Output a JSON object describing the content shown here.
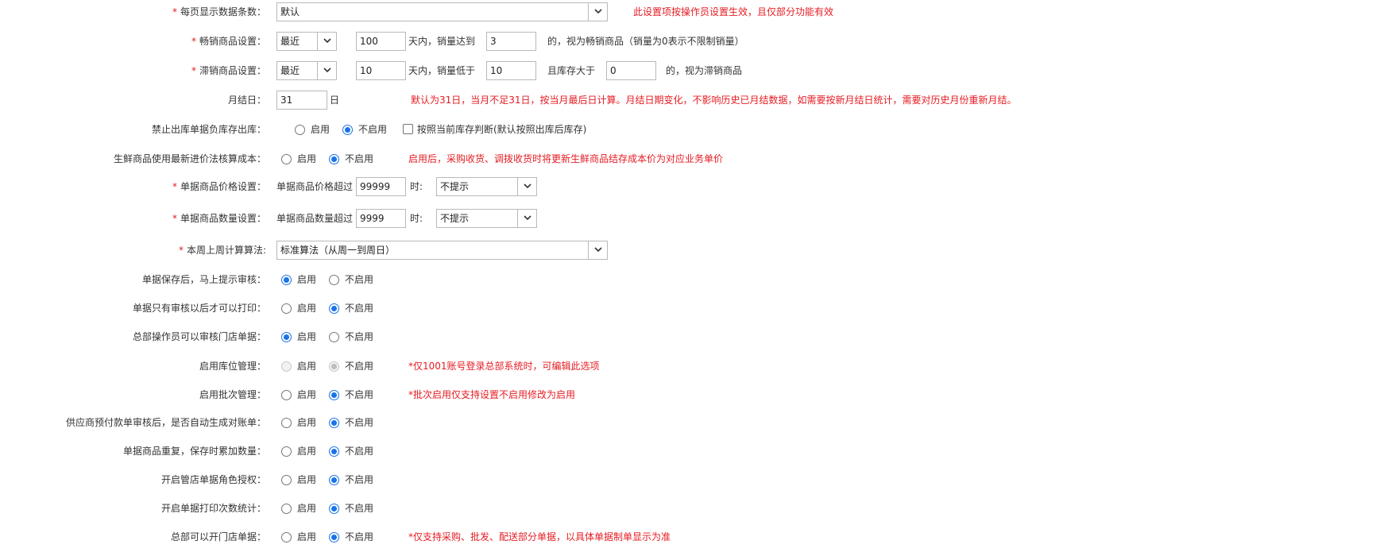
{
  "rows": {
    "page_size": {
      "required": true,
      "label": "每页显示数据条数：",
      "select_value": "默认",
      "note": "此设置项按操作员设置生效，且仅部分功能有效"
    },
    "hot_goods": {
      "required": true,
      "label": "畅销商品设置：",
      "period_select": "最近",
      "days": "100",
      "text1": "天内，销量达到",
      "qty": "3",
      "text2": "的，视为畅销商品（销量为0表示不限制销量）"
    },
    "slow_goods": {
      "required": true,
      "label": "滞销商品设置：",
      "period_select": "最近",
      "days": "10",
      "text1": "天内，销量低于",
      "qty": "10",
      "text2": "且库存大于",
      "stock": "0",
      "text3": "的，视为滞销商品"
    },
    "month_end": {
      "label": "月结日：",
      "value": "31",
      "unit": "日",
      "note": "默认为31日，当月不足31日，按当月最后日计算。月结日期变化，不影响历史已月结数据，如需要按新月结日统计，需要对历史月份重新月结。"
    },
    "forbid_negative": {
      "label": "禁止出库单据负库存出库：",
      "opt_on": "启用",
      "opt_off": "不启用",
      "selected": "off",
      "checkbox_label": "按照当前库存判断(默认按照出库后库存)",
      "checkbox_checked": false
    },
    "fresh_cost": {
      "label": "生鲜商品使用最新进价法核算成本：",
      "opt_on": "启用",
      "opt_off": "不启用",
      "selected": "off",
      "note": "启用后，采购收货、调拨收货时将更新生鲜商品结存成本价为对应业务单价"
    },
    "price_limit": {
      "required": true,
      "label": "单据商品价格设置：",
      "prefix": "单据商品价格超过",
      "value": "99999",
      "suffix": "时:",
      "select_value": "不提示"
    },
    "qty_limit": {
      "required": true,
      "label": "单据商品数量设置：",
      "prefix": "单据商品数量超过",
      "value": "9999",
      "suffix": "时:",
      "select_value": "不提示"
    },
    "week_algo": {
      "required": true,
      "label": "本周上周计算算法:",
      "select_value": "标准算法（从周一到周日）"
    },
    "prompt_audit": {
      "label": "单据保存后，马上提示审核：",
      "opt_on": "启用",
      "opt_off": "不启用",
      "selected": "on"
    },
    "print_after_audit": {
      "label": "单据只有审核以后才可以打印：",
      "opt_on": "启用",
      "opt_off": "不启用",
      "selected": "off"
    },
    "hq_audit_store": {
      "label": "总部操作员可以审核门店单据：",
      "opt_on": "启用",
      "opt_off": "不启用",
      "selected": "on"
    },
    "location_mgmt": {
      "label": "启用库位管理：",
      "opt_on": "启用",
      "opt_off": "不启用",
      "selected": "off",
      "disabled": true,
      "note": "*仅1001账号登录总部系统时，可编辑此选项"
    },
    "batch_mgmt": {
      "label": "启用批次管理：",
      "opt_on": "启用",
      "opt_off": "不启用",
      "selected": "off",
      "note": "*批次启用仅支持设置不启用修改为启用"
    },
    "supplier_prepay": {
      "label": "供应商预付款单审核后，是否自动生成对账单：",
      "opt_on": "启用",
      "opt_off": "不启用",
      "selected": "off"
    },
    "dup_goods_add": {
      "label": "单据商品重复，保存时累加数量：",
      "opt_on": "启用",
      "opt_off": "不启用",
      "selected": "off"
    },
    "store_role_auth": {
      "label": "开启管店单据角色授权：",
      "opt_on": "启用",
      "opt_off": "不启用",
      "selected": "off"
    },
    "print_count": {
      "label": "开启单据打印次数统计：",
      "opt_on": "启用",
      "opt_off": "不启用",
      "selected": "off"
    },
    "hq_open_store": {
      "label": "总部可以开门店单据：",
      "opt_on": "启用",
      "opt_off": "不启用",
      "selected": "off",
      "note": "*仅支持采购、批发、配送部分单据，以具体单据制单显示为准"
    }
  },
  "colors": {
    "required": "#e02020",
    "note": "#e51c23",
    "radio_selected": "#1a73e8"
  },
  "icons": {
    "select_arrow": "chevron-down-icon"
  }
}
